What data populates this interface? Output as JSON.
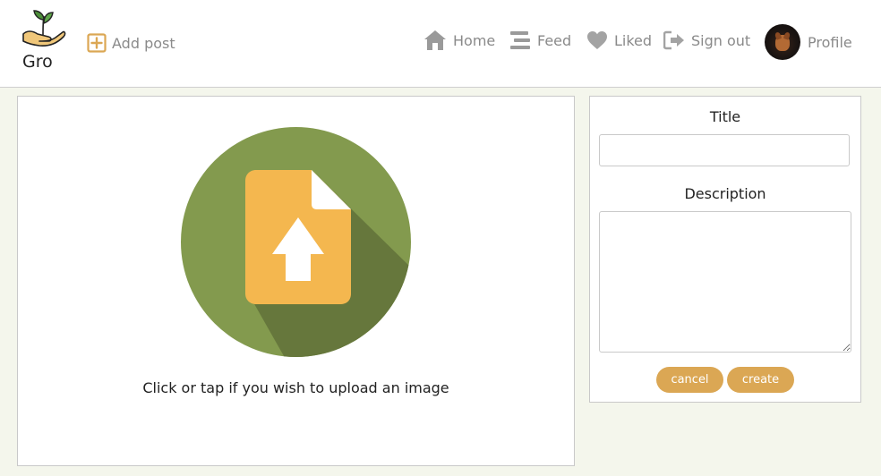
{
  "app": {
    "name": "Gro",
    "logo_icon": "seedling-in-hand-icon"
  },
  "nav": {
    "add_post": {
      "label": "Add post",
      "icon": "plus-square-icon"
    },
    "home": {
      "label": "Home",
      "icon": "home-icon"
    },
    "feed": {
      "label": "Feed",
      "icon": "feed-lines-icon"
    },
    "liked": {
      "label": "Liked",
      "icon": "heart-icon"
    },
    "sign_out": {
      "label": "Sign out",
      "icon": "sign-out-icon"
    },
    "profile": {
      "label": "Profile",
      "avatar": "dog-avatar"
    }
  },
  "upload": {
    "prompt": "Click or tap if you wish to upload an image",
    "icon": "file-upload-icon"
  },
  "form": {
    "title_label": "Title",
    "title_value": "",
    "description_label": "Description",
    "description_value": "",
    "cancel_label": "cancel",
    "create_label": "create"
  },
  "colors": {
    "background": "#f4f6ec",
    "accent": "#dba754",
    "nav_text": "#8a8a8a",
    "upload_circle": "#839a4e",
    "upload_file": "#f4b74f"
  }
}
